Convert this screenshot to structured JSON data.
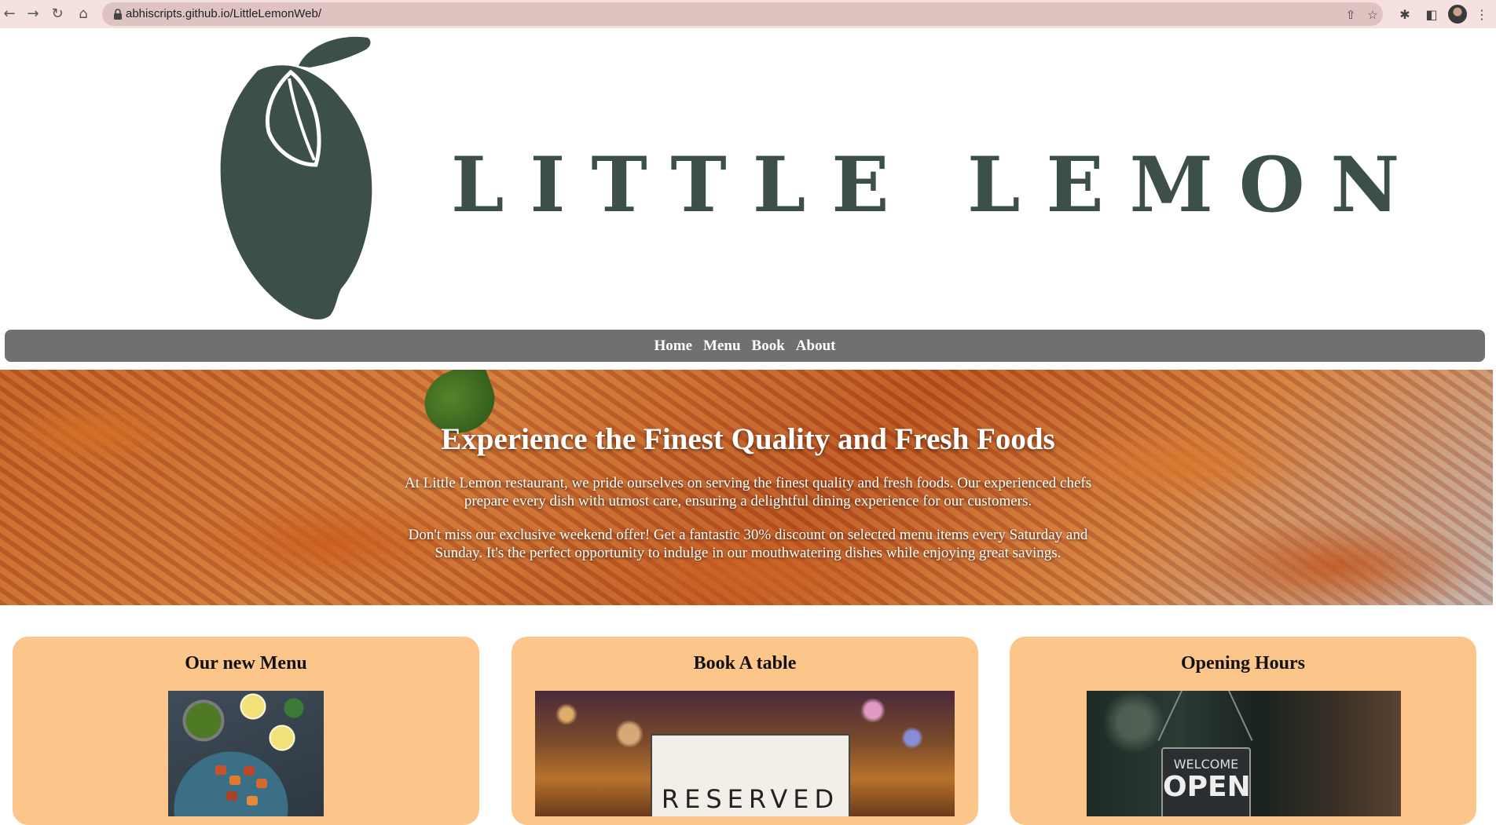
{
  "browser": {
    "url": "abhiscripts.github.io/LittleLemonWeb/"
  },
  "brand": {
    "name": "LITTLE LEMON",
    "color": "#3c4f48"
  },
  "nav": {
    "items": [
      {
        "label": "Home"
      },
      {
        "label": "Menu"
      },
      {
        "label": "Book"
      },
      {
        "label": "About"
      }
    ]
  },
  "hero": {
    "title": "Experience the Finest Quality and Fresh Foods",
    "paragraph1": [
      "At Little Lemon restaurant, we pride ourselves on serving the finest quality and fresh foods. Our experienced chefs",
      "prepare every dish with utmost care, ensuring a delightful dining experience for our customers."
    ],
    "paragraph2": [
      "Don't miss our exclusive weekend offer! Get a fantastic 30% discount on selected menu items every Saturday and",
      "Sunday. It's the perfect opportunity to indulge in our mouthwatering dishes while enjoying great savings."
    ]
  },
  "cards": [
    {
      "title": "Our new Menu"
    },
    {
      "title": "Book A table",
      "image_text": "RESERVED"
    },
    {
      "title": "Opening Hours",
      "image_text_1": "WELCOME",
      "image_text_2": "OPEN"
    }
  ],
  "colors": {
    "card_background": "#fcc58a",
    "nav_background": "#707070"
  }
}
